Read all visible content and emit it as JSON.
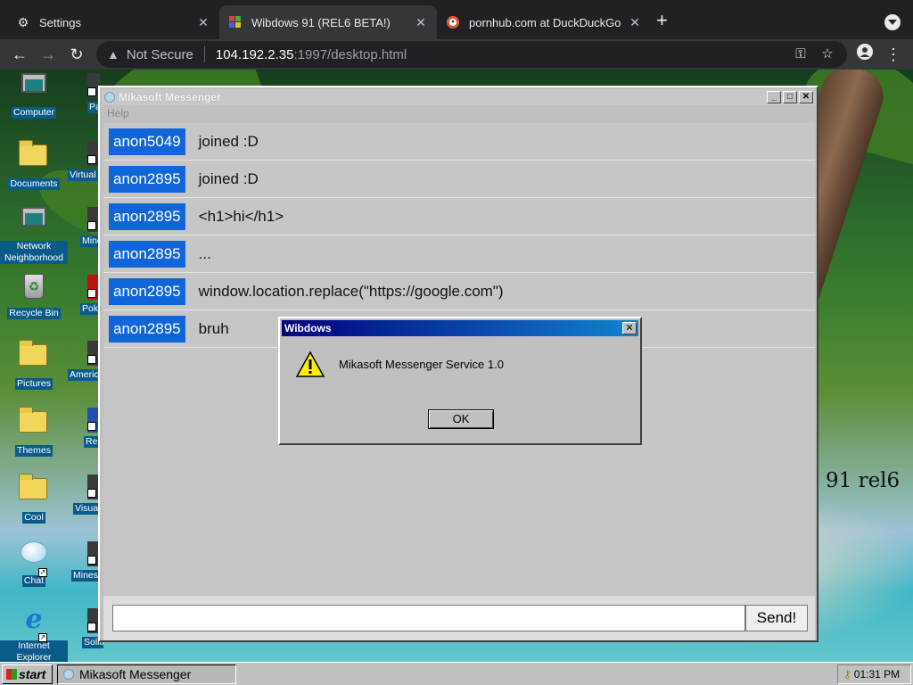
{
  "browser": {
    "tabs": [
      {
        "title": "Settings",
        "favicon": "gear-icon"
      },
      {
        "title": "Wibdows 91 (REL6 BETA!)",
        "favicon": "wibdows-icon"
      },
      {
        "title": "pornhub.com at DuckDuckGo",
        "favicon": "duckduckgo-icon"
      }
    ],
    "omnibox": {
      "security_label": "Not Secure",
      "domain": "104.192.2.35",
      "path": ":1997/desktop.html"
    }
  },
  "desktop": {
    "icons": [
      {
        "label": "Computer"
      },
      {
        "label": "Documents"
      },
      {
        "label": "Network Neighborhood"
      },
      {
        "label": "Recycle Bin"
      },
      {
        "label": "Pictures"
      },
      {
        "label": "Themes"
      },
      {
        "label": "Cool"
      },
      {
        "label": "Chat"
      },
      {
        "label": "Internet Explorer"
      }
    ],
    "icons_col2": [
      {
        "label": "Pa"
      },
      {
        "label": "Virtual"
      },
      {
        "label": "Mine"
      },
      {
        "label": "Poke"
      },
      {
        "label": "Americ"
      },
      {
        "label": "Re"
      },
      {
        "label": "Visua"
      },
      {
        "label": "Mines"
      },
      {
        "label": "Solitaire"
      }
    ],
    "wallpaper_text": "91 rel6"
  },
  "messenger": {
    "title": "Mikasoft Messenger",
    "menu": "Help",
    "messages": [
      {
        "user": "anon5049",
        "text": "joined :D"
      },
      {
        "user": "anon2895",
        "text": "joined :D"
      },
      {
        "user": "anon2895",
        "text": "<h1>hi</h1>"
      },
      {
        "user": "anon2895",
        "text": "..."
      },
      {
        "user": "anon2895",
        "text": "window.location.replace(\"https://google.com\")"
      },
      {
        "user": "anon2895",
        "text": "bruh"
      }
    ],
    "input_value": "",
    "send_label": "Send!"
  },
  "dialog": {
    "title": "Wibdows",
    "message": "Mikasoft Messenger Service 1.0",
    "ok_label": "OK"
  },
  "taskbar": {
    "start_label": "start",
    "task_label": "Mikasoft Messenger",
    "clock": "01:31 PM"
  },
  "colors": {
    "username_bg": "#1065d8",
    "dialog_title_start": "#000080",
    "dialog_title_end": "#1084d0"
  }
}
